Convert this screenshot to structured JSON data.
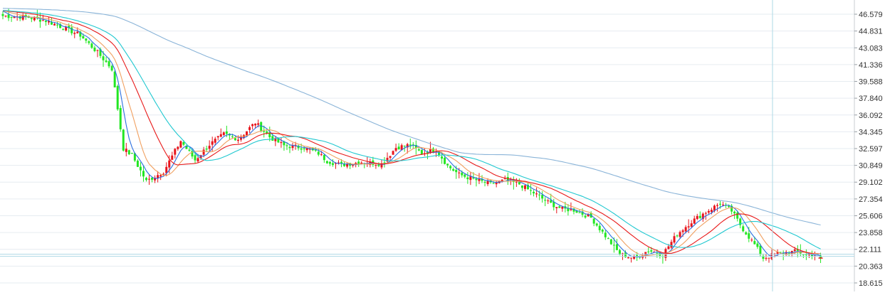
{
  "chart_data": {
    "type": "candlestick",
    "title": "",
    "y_axis": {
      "position": "right",
      "ticks": [
        "46.579",
        "44.831",
        "43.083",
        "41.336",
        "39.588",
        "37.840",
        "36.092",
        "34.345",
        "32.597",
        "30.849",
        "29.102",
        "27.354",
        "25.606",
        "23.858",
        "22.111",
        "20.363",
        "18.615"
      ],
      "range": [
        18.615,
        46.579
      ]
    },
    "grid": true,
    "colors": {
      "up": "#e8141c",
      "down": "#22e622",
      "ma5": "#2b6fe0",
      "ma10": "#f0a060",
      "ma20": "#e81818",
      "ma30": "#20c8d0",
      "ma120": "#8ab4d8",
      "grid": "#e6ecf1",
      "crosshair": "#aed8e6"
    },
    "price_path": [
      [
        0,
        46.4
      ],
      [
        8,
        46.3
      ],
      [
        15,
        45.9
      ],
      [
        20,
        45.3
      ],
      [
        27,
        44.4
      ],
      [
        33,
        42.6
      ],
      [
        38,
        40.9
      ],
      [
        42,
        32.6
      ],
      [
        45,
        31.9
      ],
      [
        50,
        29.2
      ],
      [
        56,
        30.2
      ],
      [
        62,
        33.4
      ],
      [
        67,
        31.4
      ],
      [
        72,
        33.0
      ],
      [
        77,
        34.1
      ],
      [
        82,
        33.6
      ],
      [
        88,
        35.3
      ],
      [
        93,
        33.8
      ],
      [
        98,
        32.9
      ],
      [
        105,
        32.7
      ],
      [
        110,
        32.1
      ],
      [
        113,
        31.3
      ],
      [
        118,
        30.9
      ],
      [
        125,
        31.2
      ],
      [
        132,
        31.0
      ],
      [
        137,
        32.7
      ],
      [
        142,
        33.0
      ],
      [
        146,
        32.1
      ],
      [
        151,
        32.5
      ],
      [
        155,
        30.8
      ],
      [
        159,
        29.9
      ],
      [
        164,
        29.4
      ],
      [
        170,
        28.9
      ],
      [
        175,
        29.3
      ],
      [
        180,
        28.9
      ],
      [
        186,
        27.8
      ],
      [
        190,
        27.0
      ],
      [
        195,
        26.3
      ],
      [
        199,
        26.2
      ],
      [
        205,
        25.4
      ],
      [
        210,
        23.5
      ],
      [
        215,
        21.6
      ],
      [
        220,
        21.2
      ],
      [
        225,
        22.0
      ],
      [
        230,
        21.6
      ],
      [
        235,
        23.7
      ],
      [
        240,
        25.0
      ],
      [
        245,
        26.0
      ],
      [
        250,
        26.9
      ],
      [
        254,
        26.1
      ],
      [
        258,
        24.2
      ],
      [
        262,
        22.6
      ],
      [
        265,
        21.2
      ],
      [
        270,
        21.7
      ],
      [
        277,
        21.9
      ],
      [
        280,
        21.5
      ],
      [
        283,
        21.6
      ],
      [
        285,
        21.2
      ]
    ],
    "candle_count": 286,
    "moving_averages": [
      {
        "key": "ma5",
        "window": 5
      },
      {
        "key": "ma10",
        "window": 10
      },
      {
        "key": "ma20",
        "window": 20
      },
      {
        "key": "ma30",
        "window": 30
      },
      {
        "key": "ma120",
        "window": 120
      }
    ],
    "last_price": 21.2,
    "highlighted_price": 21.6
  }
}
